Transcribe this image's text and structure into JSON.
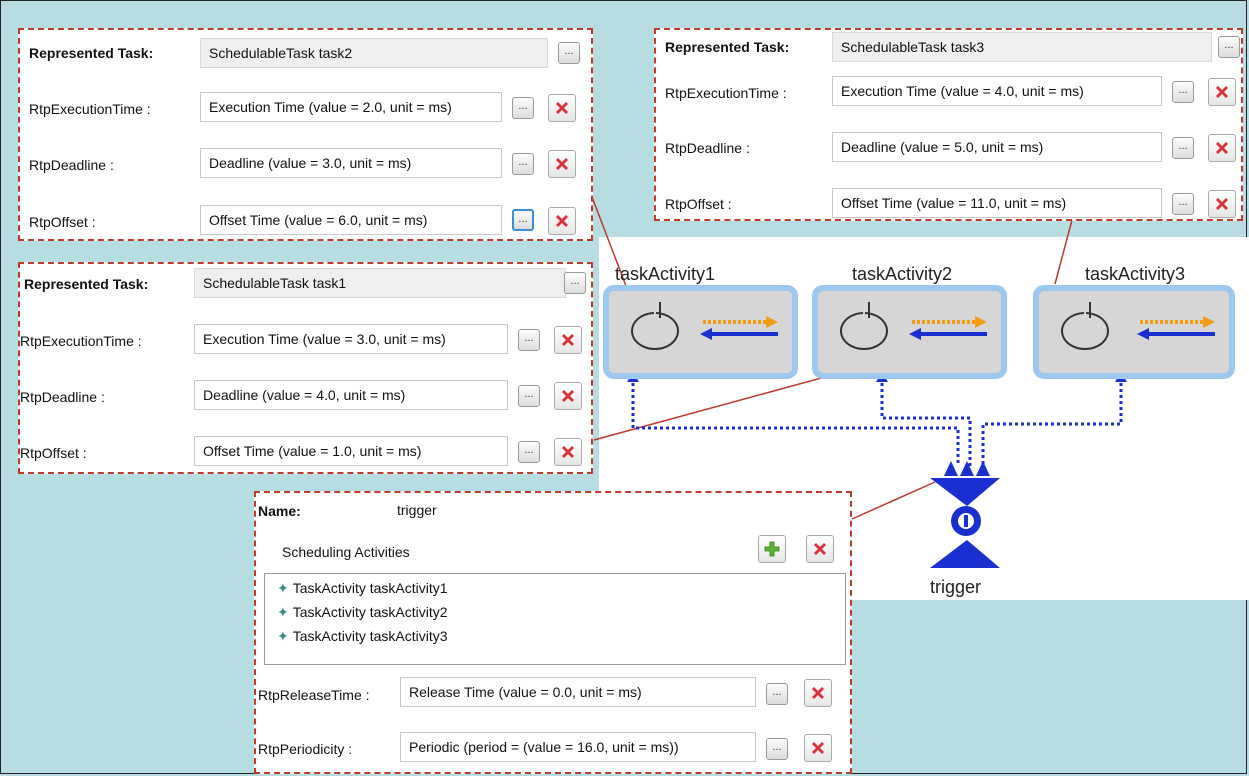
{
  "panel_task2": {
    "represented_label": "Represented Task:",
    "represented_value": "SchedulableTask task2",
    "exec_label": "RtpExecutionTime :",
    "exec_value": "Execution Time (value = 2.0, unit = ms)",
    "deadline_label": "RtpDeadline :",
    "deadline_value": "Deadline (value = 3.0, unit = ms)",
    "offset_label": "RtpOffset :",
    "offset_value": "Offset Time (value = 6.0, unit = ms)"
  },
  "panel_task3": {
    "represented_label": "Represented Task:",
    "represented_value": "SchedulableTask task3",
    "exec_label": "RtpExecutionTime :",
    "exec_value": "Execution Time (value = 4.0, unit = ms)",
    "deadline_label": "RtpDeadline :",
    "deadline_value": "Deadline (value = 5.0, unit = ms)",
    "offset_label": "RtpOffset :",
    "offset_value": "Offset Time (value = 11.0, unit = ms)"
  },
  "panel_task1": {
    "represented_label": "Represented Task:",
    "represented_value": "SchedulableTask task1",
    "exec_label": "RtpExecutionTime :",
    "exec_value": "Execution Time (value = 3.0, unit = ms)",
    "deadline_label": "RtpDeadline :",
    "deadline_value": "Deadline (value = 4.0, unit = ms)",
    "offset_label": "RtpOffset :",
    "offset_value": "Offset Time (value = 1.0, unit = ms)"
  },
  "panel_trigger": {
    "name_label": "Name:",
    "name_value": "trigger",
    "activities_label": "Scheduling Activities",
    "activities": [
      "TaskActivity taskActivity1",
      "TaskActivity taskActivity2",
      "TaskActivity taskActivity3"
    ],
    "release_label": "RtpReleaseTime :",
    "release_value": "Release Time (value = 0.0, unit = ms)",
    "periodicity_label": "RtpPeriodicity :",
    "periodicity_value": "Periodic (period = (value = 16.0, unit = ms))"
  },
  "diagram": {
    "activity1": "taskActivity1",
    "activity2": "taskActivity2",
    "activity3": "taskActivity3",
    "trigger": "trigger"
  },
  "button_glyph": "...",
  "colors": {
    "dashed_border": "#c0392b",
    "background": "#b7dde2",
    "flow": "#1a2fd0",
    "orange_arrow": "#f39c12",
    "node_border": "#9cc8f0"
  }
}
